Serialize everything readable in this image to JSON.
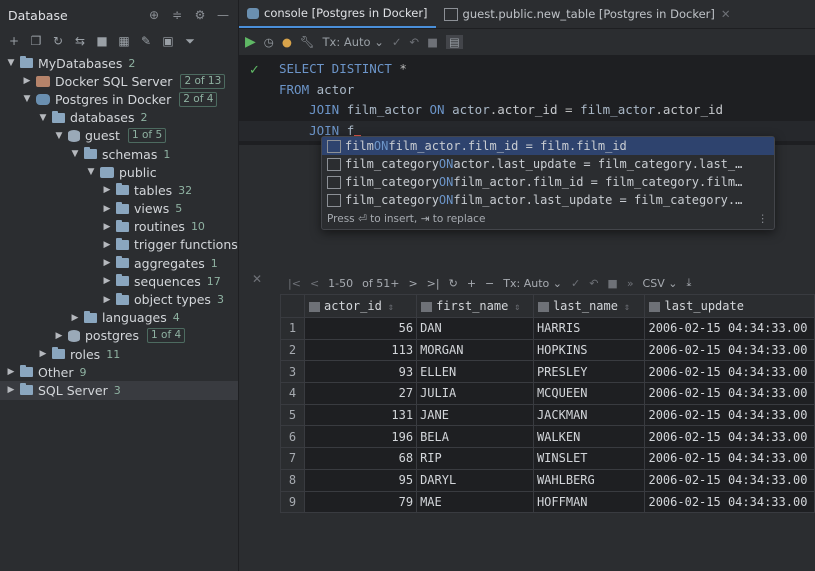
{
  "sidebar": {
    "title": "Database",
    "tree": [
      {
        "label": "MyDatabases",
        "count": "2",
        "level": 0,
        "arrow": "▼",
        "icon": "folder"
      },
      {
        "label": "Docker SQL Server",
        "badge": "2 of 13",
        "level": 1,
        "arrow": "▶",
        "icon": "sqlserver"
      },
      {
        "label": "Postgres in Docker",
        "badge": "2 of 4",
        "level": 1,
        "arrow": "▼",
        "icon": "postgres"
      },
      {
        "label": "databases",
        "count": "2",
        "level": 2,
        "arrow": "▼",
        "icon": "folder"
      },
      {
        "label": "guest",
        "badge": "1 of 5",
        "level": 3,
        "arrow": "▼",
        "icon": "db"
      },
      {
        "label": "schemas",
        "count": "1",
        "level": 4,
        "arrow": "▼",
        "icon": "folder"
      },
      {
        "label": "public",
        "level": 5,
        "arrow": "▼",
        "icon": "schema"
      },
      {
        "label": "tables",
        "count": "32",
        "level": 6,
        "arrow": "▶",
        "icon": "folder"
      },
      {
        "label": "views",
        "count": "5",
        "level": 6,
        "arrow": "▶",
        "icon": "folder"
      },
      {
        "label": "routines",
        "count": "10",
        "level": 6,
        "arrow": "▶",
        "icon": "folder"
      },
      {
        "label": "trigger functions",
        "level": 6,
        "arrow": "▶",
        "icon": "folder"
      },
      {
        "label": "aggregates",
        "count": "1",
        "level": 6,
        "arrow": "▶",
        "icon": "folder"
      },
      {
        "label": "sequences",
        "count": "17",
        "level": 6,
        "arrow": "▶",
        "icon": "folder"
      },
      {
        "label": "object types",
        "count": "3",
        "level": 6,
        "arrow": "▶",
        "icon": "folder"
      },
      {
        "label": "languages",
        "count": "4",
        "level": 4,
        "arrow": "▶",
        "icon": "folder"
      },
      {
        "label": "postgres",
        "badge": "1 of 4",
        "level": 3,
        "arrow": "▶",
        "icon": "db"
      },
      {
        "label": "roles",
        "count": "11",
        "level": 2,
        "arrow": "▶",
        "icon": "folder"
      },
      {
        "label": "Other",
        "count": "9",
        "level": 0,
        "arrow": "▶",
        "icon": "folder"
      },
      {
        "label": "SQL Server",
        "count": "3",
        "level": 0,
        "arrow": "▶",
        "icon": "folder",
        "selected": true
      }
    ]
  },
  "tabs": [
    {
      "label": "console [Postgres in Docker]",
      "active": true
    },
    {
      "label": "guest.public.new_table [Postgres in Docker]",
      "active": false
    }
  ],
  "editor": {
    "tx_mode": "Tx: Auto",
    "lines": [
      [
        {
          "t": "SELECT DISTINCT ",
          "c": "kw"
        },
        {
          "t": "*",
          "c": "op"
        }
      ],
      [
        {
          "t": "FROM ",
          "c": "kw"
        },
        {
          "t": "actor",
          "c": "id"
        }
      ],
      [
        {
          "t": "    JOIN ",
          "c": "kw"
        },
        {
          "t": "film_actor ",
          "c": "id"
        },
        {
          "t": "ON ",
          "c": "kw"
        },
        {
          "t": "actor",
          "c": "id"
        },
        {
          "t": ".",
          "c": "op"
        },
        {
          "t": "actor_id ",
          "c": "col"
        },
        {
          "t": "= ",
          "c": "op"
        },
        {
          "t": "film_actor",
          "c": "id"
        },
        {
          "t": ".",
          "c": "op"
        },
        {
          "t": "actor_id",
          "c": "col"
        }
      ],
      [
        {
          "t": "    JOIN ",
          "c": "kw"
        },
        {
          "t": "f",
          "c": "id"
        }
      ]
    ]
  },
  "autocomplete": {
    "items": [
      [
        {
          "t": "film ",
          "c": ""
        },
        {
          "t": "ON ",
          "c": "kwp"
        },
        {
          "t": "film_actor.film_id = film.film_id",
          "c": ""
        }
      ],
      [
        {
          "t": "film_category ",
          "c": ""
        },
        {
          "t": "ON ",
          "c": "kwp"
        },
        {
          "t": "actor.last_update = film_category.last_…",
          "c": ""
        }
      ],
      [
        {
          "t": "film_category ",
          "c": ""
        },
        {
          "t": "ON ",
          "c": "kwp"
        },
        {
          "t": "film_actor.film_id = film_category.film…",
          "c": ""
        }
      ],
      [
        {
          "t": "film_category ",
          "c": ""
        },
        {
          "t": "ON ",
          "c": "kwp"
        },
        {
          "t": "film_actor.last_update = film_category.…",
          "c": ""
        }
      ]
    ],
    "footer": "Press ⏎ to insert, ⇥ to replace"
  },
  "grid": {
    "pager": "1-50",
    "total": "of 51+",
    "tx_mode": "Tx: Auto",
    "export": "CSV",
    "columns": [
      "actor_id",
      "first_name",
      "last_name",
      "last_update"
    ],
    "rows": [
      [
        "1",
        "56",
        "DAN",
        "HARRIS",
        "2006-02-15 04:34:33.00"
      ],
      [
        "2",
        "113",
        "MORGAN",
        "HOPKINS",
        "2006-02-15 04:34:33.00"
      ],
      [
        "3",
        "93",
        "ELLEN",
        "PRESLEY",
        "2006-02-15 04:34:33.00"
      ],
      [
        "4",
        "27",
        "JULIA",
        "MCQUEEN",
        "2006-02-15 04:34:33.00"
      ],
      [
        "5",
        "131",
        "JANE",
        "JACKMAN",
        "2006-02-15 04:34:33.00"
      ],
      [
        "6",
        "196",
        "BELA",
        "WALKEN",
        "2006-02-15 04:34:33.00"
      ],
      [
        "7",
        "68",
        "RIP",
        "WINSLET",
        "2006-02-15 04:34:33.00"
      ],
      [
        "8",
        "95",
        "DARYL",
        "WAHLBERG",
        "2006-02-15 04:34:33.00"
      ],
      [
        "9",
        "79",
        "MAE",
        "HOFFMAN",
        "2006-02-15 04:34:33.00"
      ]
    ]
  }
}
